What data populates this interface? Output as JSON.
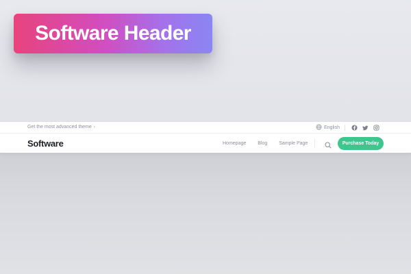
{
  "badge": {
    "title": "Software Header"
  },
  "topbar": {
    "promo_text": "Get the most advanced theme",
    "promo_chevron": "›",
    "language": "English",
    "language_icon": "globe-icon",
    "socials": [
      "facebook-icon",
      "twitter-icon",
      "instagram-icon"
    ]
  },
  "navbar": {
    "logo": "Software",
    "links": [
      "Homepage",
      "Blog",
      "Sample Page"
    ],
    "search_icon": "search-icon",
    "cta_label": "Purchase Today"
  },
  "colors": {
    "badge_gradient": [
      "#e8437d",
      "#d24dbf",
      "#a571ea",
      "#8a86f3"
    ],
    "cta": "#3fc68f",
    "muted_text": "#8c8f99",
    "logo_text": "#1f2026"
  }
}
